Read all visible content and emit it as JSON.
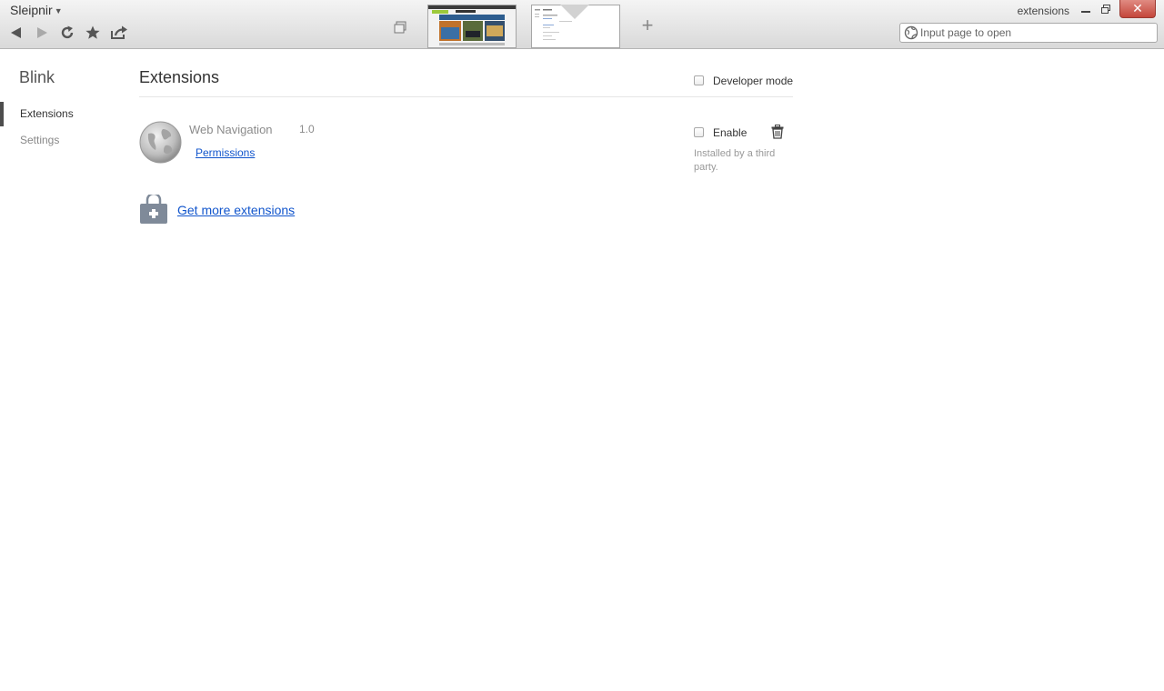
{
  "window": {
    "app_menu_label": "Sleipnir",
    "title": "extensions",
    "close_glyph": "✕"
  },
  "toolbar": {
    "icons": [
      "back-arrow-icon",
      "forward-arrow-icon",
      "reload-icon",
      "star-icon",
      "share-icon"
    ],
    "new_tab_glyph": "+"
  },
  "address_bar": {
    "placeholder": "Input page to open",
    "value": ""
  },
  "sidebar": {
    "title": "Blink",
    "items": [
      {
        "label": "Extensions",
        "active": true
      },
      {
        "label": "Settings",
        "active": false
      }
    ]
  },
  "main": {
    "title": "Extensions",
    "developer_mode": {
      "label": "Developer mode",
      "checked": false
    },
    "extensions": [
      {
        "name": "Web Navigation",
        "version": "1.0",
        "permissions_label": "Permissions",
        "enable_label": "Enable",
        "enabled": false,
        "note": "Installed by a third party."
      }
    ],
    "get_more_label": "Get more extensions"
  },
  "colors": {
    "link": "#1155cc",
    "sidebar_active": "#4d4d4d",
    "close_button": "#c4463a"
  }
}
